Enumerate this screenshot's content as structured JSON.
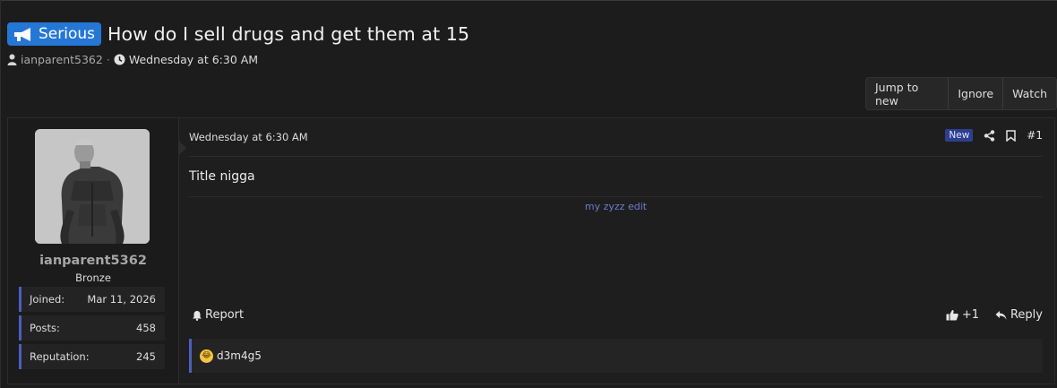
{
  "thread": {
    "prefix": "Serious",
    "title": "How do I sell drugs and get them at 15",
    "author": "ianparent5362",
    "separator": "·",
    "date": "Wednesday at 6:30 AM"
  },
  "actions": {
    "jump_to_new": "Jump to new",
    "ignore": "Ignore",
    "watch": "Watch"
  },
  "user": {
    "name": "ianparent5362",
    "title": "Bronze",
    "stats": [
      {
        "label": "Joined:",
        "value": "Mar 11, 2026"
      },
      {
        "label": "Posts:",
        "value": "458"
      },
      {
        "label": "Reputation:",
        "value": "245"
      }
    ]
  },
  "post": {
    "date": "Wednesday at 6:30 AM",
    "new_badge": "New",
    "number": "#1",
    "message": "Title nigga",
    "signature": "my zyzz edit",
    "report_label": "Report",
    "like_count": "+1",
    "reply_label": "Reply",
    "reaction_user": "d3m4g5"
  },
  "colors": {
    "prefix_bg": "#2577d6",
    "accent": "#4b5fbd",
    "new_badge_bg": "#2e3f8f",
    "signature_link": "#6f7ccf"
  },
  "icons": {
    "prefix": "megaphone-icon",
    "author": "user-icon",
    "date": "clock-icon",
    "share": "share-icon",
    "bookmark": "bookmark-icon",
    "report": "bell-icon",
    "like": "thumbs-up-icon",
    "reply": "reply-icon",
    "reaction": "laughing-crying-emoji-icon"
  }
}
